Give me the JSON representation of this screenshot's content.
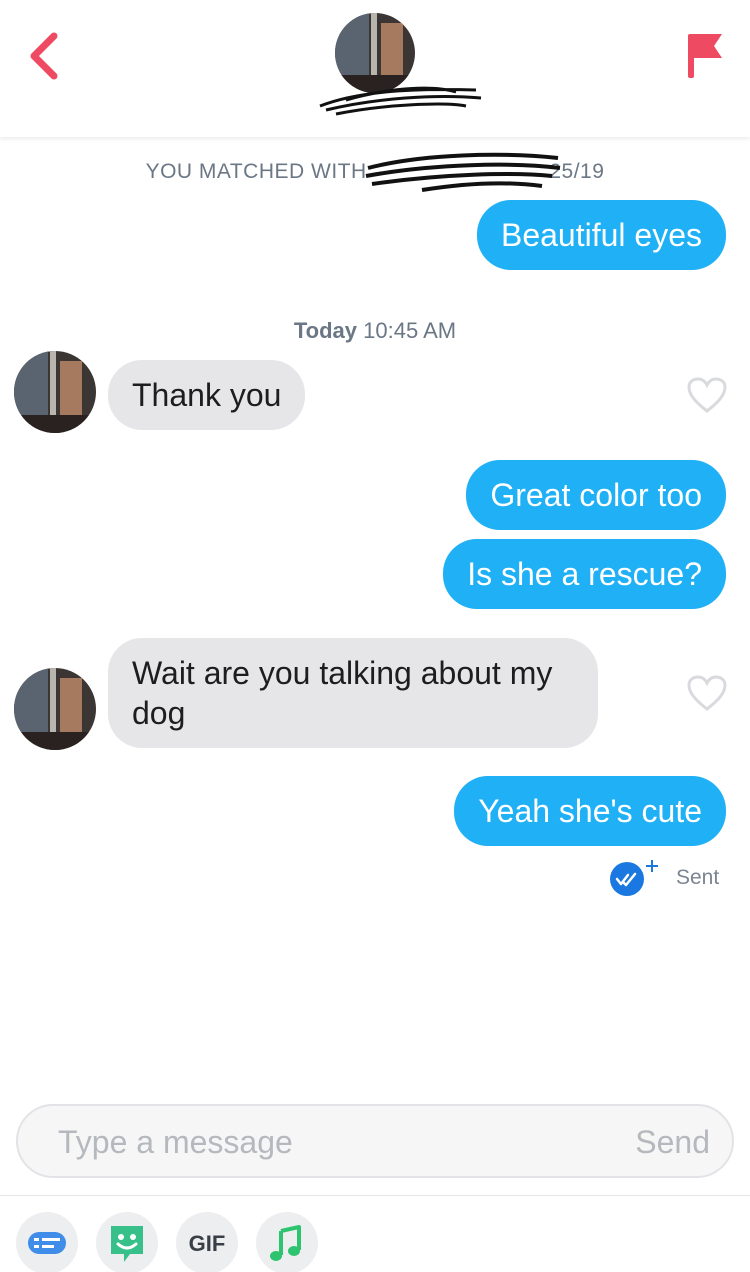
{
  "header": {
    "back_icon": "chevron-left-icon",
    "flag_icon": "report-flag-icon",
    "accent_color": "#ee4a62"
  },
  "match_line": {
    "text": "YOU MATCHED WITH",
    "date_tail": "25/19"
  },
  "timestamp": {
    "day": "Today",
    "time": "10:45 AM"
  },
  "messages": [
    {
      "side": "out",
      "text": "Beautiful eyes"
    },
    {
      "side": "in",
      "text": "Thank you"
    },
    {
      "side": "out",
      "text": "Great color too"
    },
    {
      "side": "out",
      "text": "Is she a rescue?"
    },
    {
      "side": "in",
      "text": "Wait are you talking about my dog"
    },
    {
      "side": "out",
      "text": "Yeah she's cute"
    }
  ],
  "status": {
    "label": "Sent",
    "icon": "read-receipt-check-icon"
  },
  "composer": {
    "placeholder": "Type a message",
    "send_label": "Send"
  },
  "toolbar": {
    "gif_label": "GIF",
    "icons": [
      "keyboard-chat-icon",
      "sticker-icon",
      "gif-icon",
      "music-note-icon"
    ]
  },
  "colors": {
    "outgoing_bubble": "#1fb0f5",
    "incoming_bubble": "#e6e6e8",
    "read_receipt": "#1a78e0",
    "sticker_green": "#37c08a",
    "music_green": "#2ec46f"
  }
}
